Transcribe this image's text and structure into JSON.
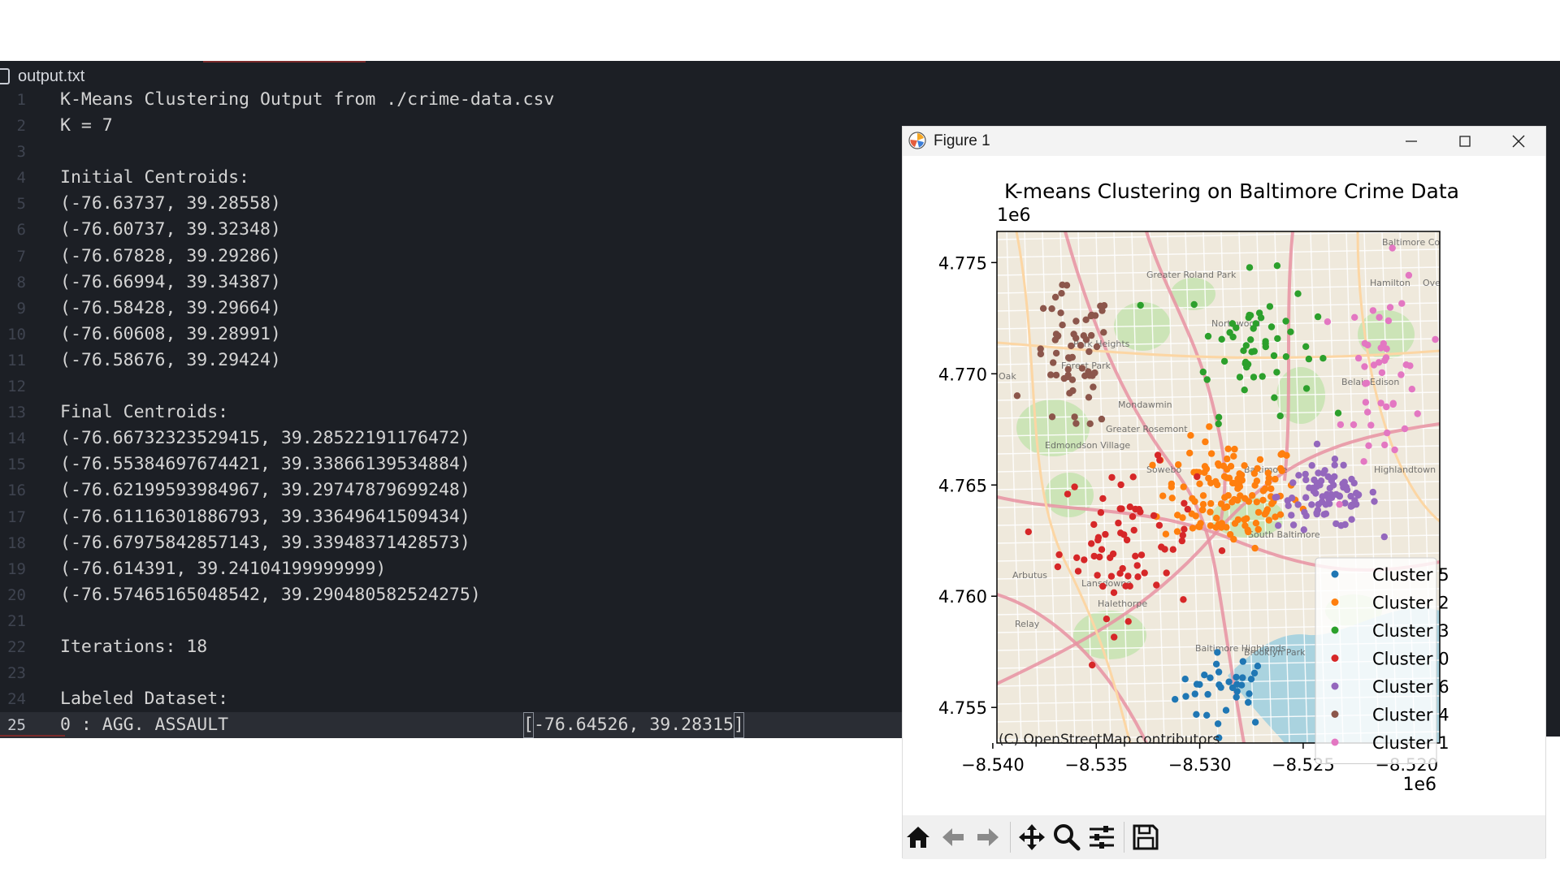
{
  "editor": {
    "file_name": "output.txt",
    "lines": [
      {
        "n": "1",
        "text": "K-Means Clustering Output from ./crime-data.csv"
      },
      {
        "n": "2",
        "text": "K = 7"
      },
      {
        "n": "3",
        "text": ""
      },
      {
        "n": "4",
        "text": "Initial Centroids:"
      },
      {
        "n": "5",
        "text": "(-76.63737, 39.28558)"
      },
      {
        "n": "6",
        "text": "(-76.60737, 39.32348)"
      },
      {
        "n": "7",
        "text": "(-76.67828, 39.29286)"
      },
      {
        "n": "8",
        "text": "(-76.66994, 39.34387)"
      },
      {
        "n": "9",
        "text": "(-76.58428, 39.29664)"
      },
      {
        "n": "10",
        "text": "(-76.60608, 39.28991)"
      },
      {
        "n": "11",
        "text": "(-76.58676, 39.29424)"
      },
      {
        "n": "12",
        "text": ""
      },
      {
        "n": "13",
        "text": "Final Centroids:"
      },
      {
        "n": "14",
        "text": "(-76.66732323529415, 39.28522191176472)"
      },
      {
        "n": "15",
        "text": "(-76.55384697674421, 39.33866139534884)"
      },
      {
        "n": "16",
        "text": "(-76.62199593984967, 39.29747879699248)"
      },
      {
        "n": "17",
        "text": "(-76.61116301886793, 39.33649641509434)"
      },
      {
        "n": "18",
        "text": "(-76.67975842857143, 39.33948371428573)"
      },
      {
        "n": "19",
        "text": "(-76.614391, 39.24104199999999)"
      },
      {
        "n": "20",
        "text": "(-76.57465165048542, 39.290480582524275)"
      },
      {
        "n": "21",
        "text": ""
      },
      {
        "n": "22",
        "text": "Iterations: 18"
      },
      {
        "n": "23",
        "text": ""
      },
      {
        "n": "24",
        "text": "Labeled Dataset:"
      }
    ],
    "active_line": {
      "n": "25",
      "text": "0 : AGG. ASSAULT",
      "bracket_open": "[",
      "coords": "-76.64526, 39.28315",
      "bracket_close": "]"
    }
  },
  "figure": {
    "window_title": "Figure 1",
    "toolbar": [
      "home-icon",
      "back-arrow-icon",
      "forward-arrow-icon",
      "pan-icon",
      "zoom-icon",
      "configure-subplots-icon",
      "save-icon"
    ]
  },
  "chart_data": {
    "type": "scatter",
    "title": "K-means Clustering on Baltimore Crime Data",
    "x_offset_label": "1e6",
    "y_offset_label": "1e6",
    "xlim": [
      -8.5398,
      -8.5184
    ],
    "ylim": [
      4.7534,
      4.7764
    ],
    "x_ticks": [
      -8.54,
      -8.535,
      -8.53,
      -8.525,
      -8.52
    ],
    "x_tick_labels": [
      "−8.540",
      "−8.535",
      "−8.530",
      "−8.525",
      "−8.520"
    ],
    "y_ticks": [
      4.755,
      4.76,
      4.765,
      4.77,
      4.775
    ],
    "y_tick_labels": [
      "4.755",
      "4.760",
      "4.765",
      "4.770",
      "4.775"
    ],
    "basemap_attribution": "(C) OpenStreetMap contributors",
    "basemap_labels": [
      "Greater Roland Park",
      "Northwood",
      "Hamilton",
      "Overlea",
      "Park Heights",
      "Forest Park",
      "Oak",
      "Mondawmin",
      "Greater Rosemont",
      "Edmondson Village",
      "Belair-Edison",
      "Sowebo",
      "Baltimore",
      "Highlandtown",
      "South Baltimore",
      "Arbutus",
      "Lansdowne",
      "Halethorpe",
      "Baltimore Highlands",
      "Brooklyn Park",
      "Relay",
      "Baltimore County"
    ],
    "legend_position": "lower-right",
    "series": [
      {
        "name": "Cluster 5",
        "color": "#1f77b4",
        "centroid": [
          -8.5287,
          4.7558
        ],
        "spread": [
          0.0022,
          0.0015
        ],
        "count": 34
      },
      {
        "name": "Cluster 2",
        "color": "#ff7f0e",
        "centroid": [
          -8.5285,
          4.7646
        ],
        "spread": [
          0.003,
          0.0022
        ],
        "count": 130
      },
      {
        "name": "Cluster 3",
        "color": "#2ca02c",
        "centroid": [
          -8.5275,
          4.7713
        ],
        "spread": [
          0.0028,
          0.0028
        ],
        "count": 55
      },
      {
        "name": "Cluster 0",
        "color": "#d62728",
        "centroid": [
          -8.5335,
          4.7625
        ],
        "spread": [
          0.003,
          0.003
        ],
        "count": 70
      },
      {
        "name": "Cluster 6",
        "color": "#9467bd",
        "centroid": [
          -8.5238,
          4.7645
        ],
        "spread": [
          0.0022,
          0.0013
        ],
        "count": 85
      },
      {
        "name": "Cluster 4",
        "color": "#8c564b",
        "centroid": [
          -8.5362,
          4.7705
        ],
        "spread": [
          0.0018,
          0.003
        ],
        "count": 60
      },
      {
        "name": "Cluster 1",
        "color": "#e377c2",
        "centroid": [
          -8.521,
          4.77
        ],
        "spread": [
          0.0018,
          0.0042
        ],
        "count": 45
      }
    ]
  }
}
